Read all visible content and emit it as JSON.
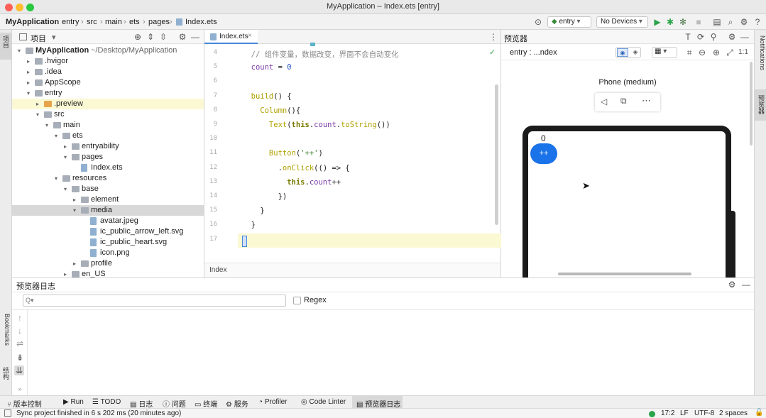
{
  "window": {
    "title": "MyApplication – Index.ets [entry]"
  },
  "breadcrumb": [
    "MyApplication",
    "entry",
    "src",
    "main",
    "ets",
    "pages",
    "Index.ets"
  ],
  "toolbar": {
    "module": "entry",
    "device": "No Devices"
  },
  "left_strip": {
    "project_tab": "项目",
    "bookmarks_tab": "Bookmarks",
    "structure_tab": "结构"
  },
  "project": {
    "title": "项目",
    "tree": [
      {
        "label": "MyApplication",
        "suffix": "~/Desktop/MyApplication",
        "depth": 0,
        "expanded": "open",
        "kind": "folder"
      },
      {
        "label": ".hvigor",
        "depth": 1,
        "expanded": "closed",
        "kind": "folder"
      },
      {
        "label": ".idea",
        "depth": 1,
        "expanded": "closed",
        "kind": "folder"
      },
      {
        "label": "AppScope",
        "depth": 1,
        "expanded": "closed",
        "kind": "folder"
      },
      {
        "label": "entry",
        "depth": 1,
        "expanded": "open",
        "kind": "folder"
      },
      {
        "label": ".preview",
        "depth": 2,
        "expanded": "closed",
        "kind": "folder-orange",
        "state": "highlight"
      },
      {
        "label": "src",
        "depth": 2,
        "expanded": "open",
        "kind": "folder"
      },
      {
        "label": "main",
        "depth": 3,
        "expanded": "open",
        "kind": "folder"
      },
      {
        "label": "ets",
        "depth": 4,
        "expanded": "open",
        "kind": "folder"
      },
      {
        "label": "entryability",
        "depth": 5,
        "expanded": "closed",
        "kind": "folder"
      },
      {
        "label": "pages",
        "depth": 5,
        "expanded": "open",
        "kind": "folder"
      },
      {
        "label": "Index.ets",
        "depth": 6,
        "expanded": "none",
        "kind": "file"
      },
      {
        "label": "resources",
        "depth": 4,
        "expanded": "open",
        "kind": "folder"
      },
      {
        "label": "base",
        "depth": 5,
        "expanded": "open",
        "kind": "folder"
      },
      {
        "label": "element",
        "depth": 6,
        "expanded": "closed",
        "kind": "folder"
      },
      {
        "label": "media",
        "depth": 6,
        "expanded": "open",
        "kind": "folder",
        "state": "selected"
      },
      {
        "label": "avatar.jpeg",
        "depth": 7,
        "expanded": "none",
        "kind": "file"
      },
      {
        "label": "ic_public_arrow_left.svg",
        "depth": 7,
        "expanded": "none",
        "kind": "file"
      },
      {
        "label": "ic_public_heart.svg",
        "depth": 7,
        "expanded": "none",
        "kind": "file"
      },
      {
        "label": "icon.png",
        "depth": 7,
        "expanded": "none",
        "kind": "file"
      },
      {
        "label": "profile",
        "depth": 6,
        "expanded": "closed",
        "kind": "folder"
      },
      {
        "label": "en_US",
        "depth": 5,
        "expanded": "closed",
        "kind": "folder"
      }
    ]
  },
  "editor": {
    "tab_label": "Index.ets",
    "footer_label": "Index",
    "lines": [
      {
        "n": "4",
        "parts": [
          [
            "cm",
            "  // 组件变量，数据改变，界面不会自动变化"
          ]
        ]
      },
      {
        "n": "5",
        "parts": [
          [
            "var",
            "  count"
          ],
          [
            "plain",
            " = "
          ],
          [
            "num",
            "0"
          ]
        ]
      },
      {
        "n": "6",
        "parts": []
      },
      {
        "n": "7",
        "parts": [
          [
            "fn",
            "  build"
          ],
          [
            "plain",
            "() {"
          ]
        ]
      },
      {
        "n": "8",
        "parts": [
          [
            "fn",
            "    Column"
          ],
          [
            "plain",
            "(){"
          ]
        ]
      },
      {
        "n": "9",
        "parts": [
          [
            "fn",
            "      Text"
          ],
          [
            "plain",
            "("
          ],
          [
            "kw2",
            "this"
          ],
          [
            "plain",
            "."
          ],
          [
            "var",
            "count"
          ],
          [
            "plain",
            "."
          ],
          [
            "fn",
            "toString"
          ],
          [
            "plain",
            "())"
          ]
        ]
      },
      {
        "n": "10",
        "parts": []
      },
      {
        "n": "11",
        "parts": [
          [
            "fn",
            "      Button"
          ],
          [
            "plain",
            "("
          ],
          [
            "str",
            "'++'"
          ],
          [
            "plain",
            ")"
          ]
        ]
      },
      {
        "n": "12",
        "parts": [
          [
            "plain",
            "        ."
          ],
          [
            "fn",
            "onClick"
          ],
          [
            "plain",
            "(() => {"
          ]
        ]
      },
      {
        "n": "13",
        "parts": [
          [
            "kw2",
            "          this"
          ],
          [
            "plain",
            "."
          ],
          [
            "var",
            "count"
          ],
          [
            "plain",
            "++"
          ]
        ]
      },
      {
        "n": "14",
        "parts": [
          [
            "plain",
            "        })"
          ]
        ]
      },
      {
        "n": "15",
        "parts": [
          [
            "plain",
            "    }"
          ]
        ]
      },
      {
        "n": "16",
        "parts": [
          [
            "plain",
            "  }"
          ]
        ]
      },
      {
        "n": "17",
        "parts": [
          [
            "plain",
            "}"
          ]
        ]
      }
    ]
  },
  "preview": {
    "panel_title": "预览器",
    "page_label": "entry : ...ndex",
    "device_name": "Phone (medium)",
    "screen_text": "0",
    "button_label": "++"
  },
  "right_strip": {
    "notifications_tab": "Notifications",
    "previewer_tab": "预览器"
  },
  "log": {
    "title": "预览器日志",
    "search_placeholder": "Q▾",
    "regex_label": "Regex"
  },
  "bottom_tabs": [
    "版本控制",
    "Run",
    "TODO",
    "日志",
    "问题",
    "终端",
    "服务",
    "Profiler",
    "Code Linter",
    "预览器日志"
  ],
  "status": {
    "message": "Sync project finished in 6 s 202 ms (20 minutes ago)",
    "position": "17:2",
    "line_sep": "LF",
    "encoding": "UTF-8",
    "indent": "2 spaces"
  },
  "colors": {
    "accent": "#2f74d9",
    "highlight": "#fbf8d4",
    "preview_button": "#1a73e8"
  }
}
